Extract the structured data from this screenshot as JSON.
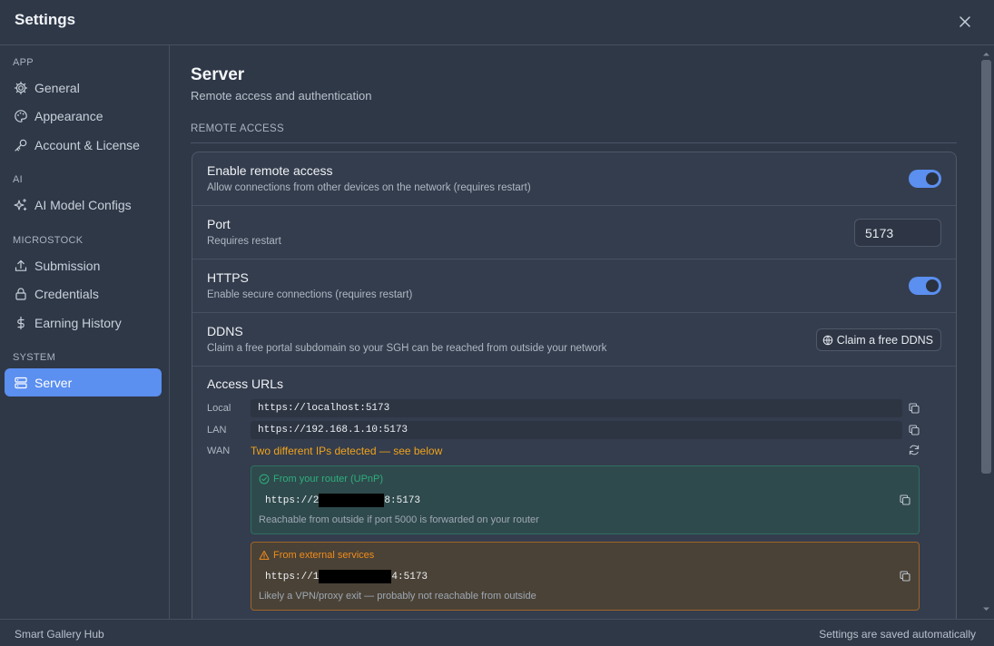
{
  "window": {
    "title": "Settings"
  },
  "sidebar": {
    "sections": [
      {
        "label": "APP",
        "items": [
          {
            "label": "General",
            "icon": "gear-icon"
          },
          {
            "label": "Appearance",
            "icon": "palette-icon"
          },
          {
            "label": "Account & License",
            "icon": "key-icon"
          }
        ]
      },
      {
        "label": "AI",
        "items": [
          {
            "label": "AI Model Configs",
            "icon": "sparkles-icon"
          }
        ]
      },
      {
        "label": "MICROSTOCK",
        "items": [
          {
            "label": "Submission",
            "icon": "upload-icon"
          },
          {
            "label": "Credentials",
            "icon": "lock-icon"
          },
          {
            "label": "Earning History",
            "icon": "dollar-icon"
          }
        ]
      },
      {
        "label": "SYSTEM",
        "items": [
          {
            "label": "Server",
            "icon": "server-icon",
            "active": true
          }
        ]
      }
    ]
  },
  "page": {
    "title": "Server",
    "subtitle": "Remote access and authentication",
    "group_label": "REMOTE ACCESS",
    "remote_access": {
      "label": "Enable remote access",
      "desc": "Allow connections from other devices on the network (requires restart)",
      "enabled": true
    },
    "port": {
      "label": "Port",
      "desc": "Requires restart",
      "value": "5173"
    },
    "https": {
      "label": "HTTPS",
      "desc": "Enable secure connections (requires restart)",
      "enabled": true
    },
    "ddns": {
      "label": "DDNS",
      "desc": "Claim a free portal subdomain so your SGH can be reached from outside your network",
      "button": "Claim a free DDNS"
    },
    "access_urls": {
      "title": "Access URLs",
      "local_label": "Local",
      "local_url": "https://localhost:5173",
      "lan_label": "LAN",
      "lan_url": "https://192.168.1.10:5173",
      "wan_label": "WAN",
      "wan_message": "Two different IPs detected — see below",
      "router": {
        "heading": "From your router (UPnP)",
        "url_prefix": "https://2",
        "url_suffix": "8:5173",
        "note": "Reachable from outside if port 5000 is forwarded on your router"
      },
      "external": {
        "heading": "From external services",
        "url_prefix": "https://1",
        "url_suffix": "4:5173",
        "note": "Likely a VPN/proxy exit — probably not reachable from outside"
      }
    }
  },
  "footer": {
    "app_name": "Smart Gallery Hub",
    "status": "Settings are saved automatically"
  },
  "colors": {
    "accent": "#5b8ff0",
    "warning": "#f0a21c",
    "success": "#2fae7e"
  }
}
